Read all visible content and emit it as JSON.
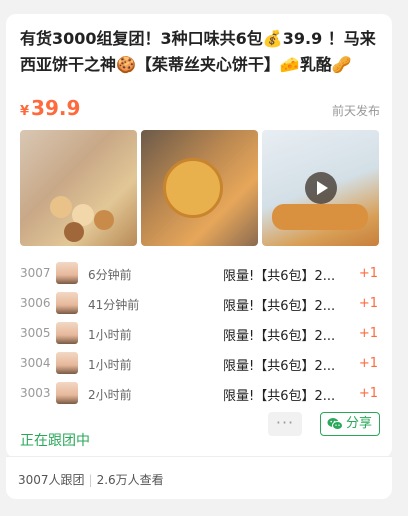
{
  "post": {
    "title": "有货3000组复团！3种口味共6包💰39.9 ！马来西亚饼干之神🍪【茱蒂丝夹心饼干】🧀乳酪🥜花...",
    "price_symbol": "¥",
    "price": "39.9",
    "published": "前天发布"
  },
  "photos": [
    {
      "name": "cookie-assortment-photo"
    },
    {
      "name": "cookie-in-hand-photo"
    },
    {
      "name": "cookie-video-thumbnail",
      "has_play_icon": true
    }
  ],
  "orders": [
    {
      "num": "3007",
      "time": "6分钟前",
      "item": "限量!【共6包】2...",
      "qty": "+1"
    },
    {
      "num": "3006",
      "time": "41分钟前",
      "item": "限量!【共6包】2...",
      "qty": "+1"
    },
    {
      "num": "3005",
      "time": "1小时前",
      "item": "限量!【共6包】2...",
      "qty": "+1"
    },
    {
      "num": "3004",
      "time": "1小时前",
      "item": "限量!【共6包】2...",
      "qty": "+1"
    },
    {
      "num": "3003",
      "time": "2小时前",
      "item": "限量!【共6包】2...",
      "qty": "+1"
    }
  ],
  "status": "正在跟团中",
  "more_label": "···",
  "share_label": "分享",
  "stats": {
    "participants": "3007人跟团",
    "views": "2.6万人查看"
  },
  "colors": {
    "accent_orange": "#ff6a3d",
    "accent_green": "#2aa85a"
  }
}
